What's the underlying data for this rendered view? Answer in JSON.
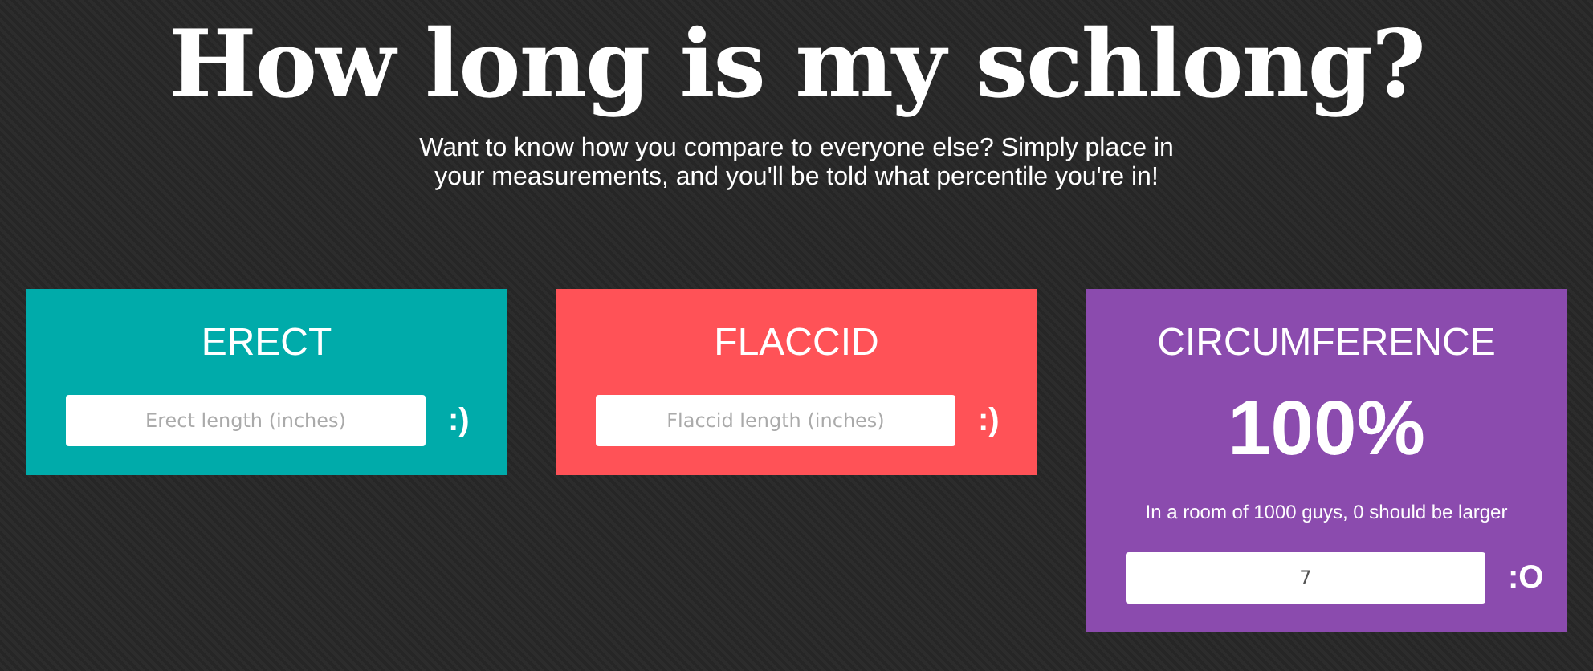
{
  "title": "How long is my schlong?",
  "intro": "Want to know how you compare to everyone else? Simply place in your measurements, and you'll be told what percentile you're in!",
  "cards": [
    {
      "title": "ERECT",
      "color": "#00abaa",
      "placeholder": "Erect length (inches)",
      "face": ":)"
    },
    {
      "title": "FLACCID",
      "color": "#ff5257",
      "placeholder": "Flaccid length (inches)",
      "face": ":)"
    },
    {
      "title": "CIRCUMFERENCE",
      "color": "#8b4bae",
      "percentile": "100%",
      "note": "In a room of 1000 guys, 0 should be larger",
      "value": "7",
      "face": ":O"
    }
  ]
}
